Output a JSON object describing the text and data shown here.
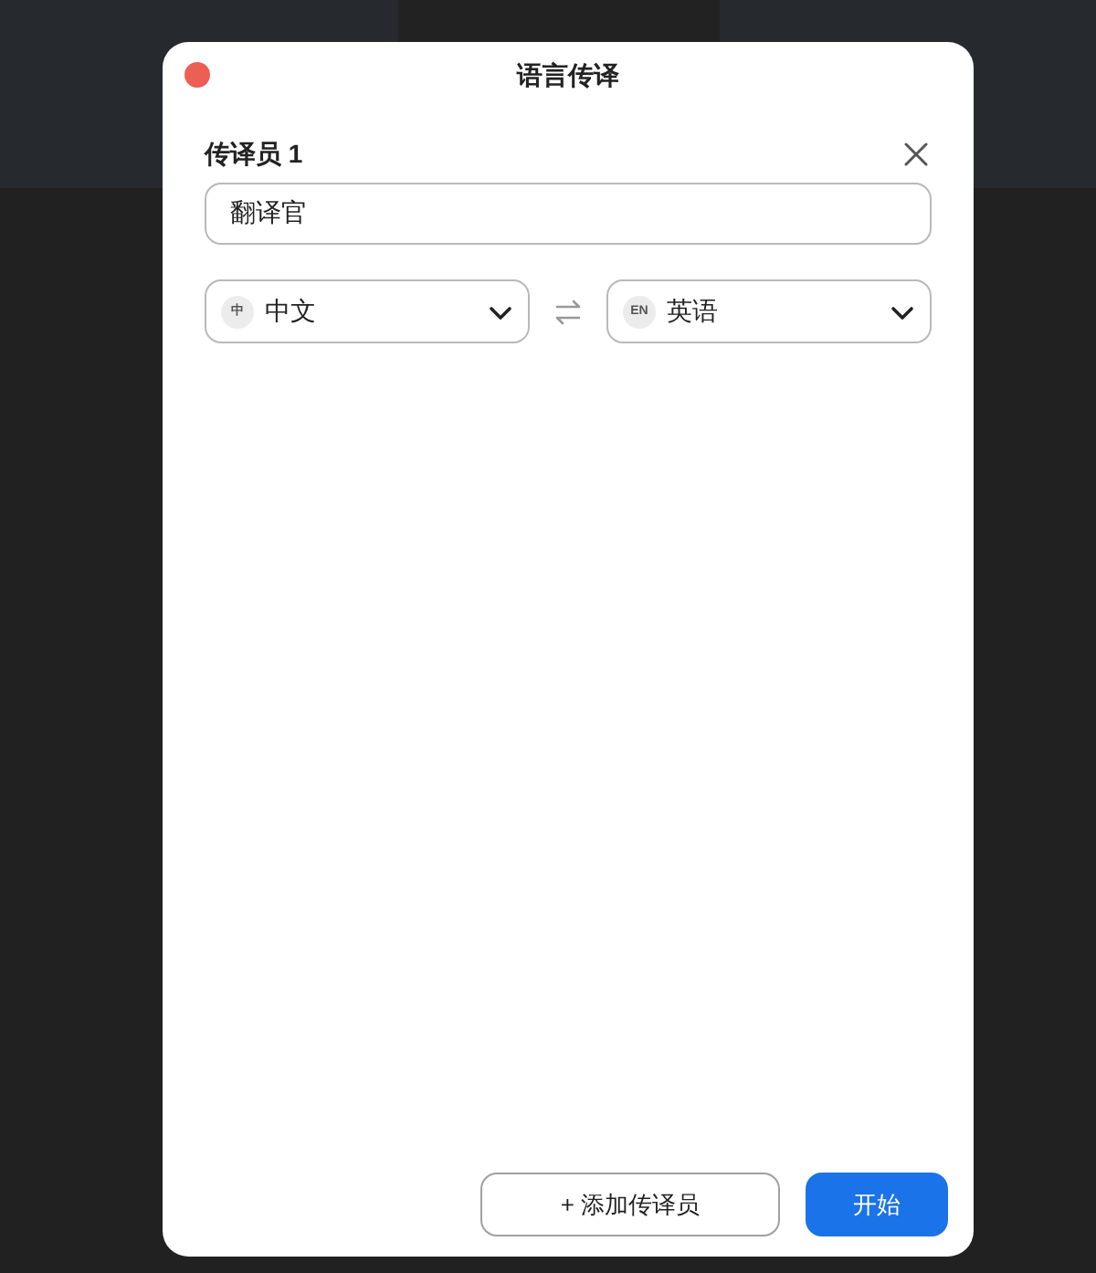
{
  "window": {
    "title": "语言传译"
  },
  "interpreter": {
    "heading": "传译员 1",
    "name_value": "翻译官",
    "languages": [
      {
        "badge": "中",
        "label": "中文"
      },
      {
        "badge": "EN",
        "label": "英语"
      }
    ]
  },
  "buttons": {
    "add": "+ 添加传译员",
    "start": "开始"
  }
}
